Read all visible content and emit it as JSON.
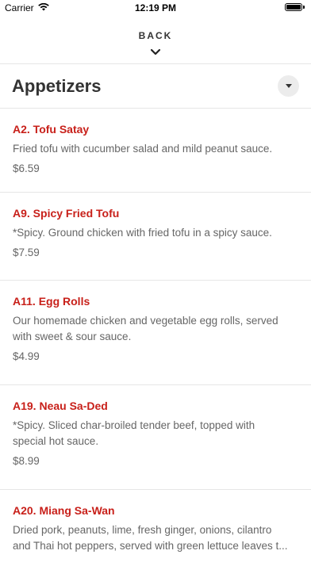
{
  "status_bar": {
    "carrier": "Carrier",
    "time": "12:19 PM",
    "battery_level": 1.0
  },
  "header": {
    "back_label": "BACK"
  },
  "section": {
    "title": "Appetizers"
  },
  "items": [
    {
      "name": "A2. Tofu Satay",
      "description_lines": [
        "Fried tofu with cucumber salad and mild peanut sauce."
      ],
      "price": "$6.59"
    },
    {
      "name": "A9. Spicy Fried Tofu",
      "description_lines": [
        "*Spicy. Ground chicken with fried tofu in a spicy sauce."
      ],
      "price": "$7.59"
    },
    {
      "name": "A11. Egg Rolls",
      "description_lines": [
        "Our homemade chicken and vegetable egg rolls, served",
        "with sweet & sour sauce."
      ],
      "price": "$4.99"
    },
    {
      "name": "A19. Neau Sa-Ded",
      "description_lines": [
        "*Spicy. Sliced char-broiled tender beef, topped with",
        "special hot sauce."
      ],
      "price": "$8.99"
    },
    {
      "name": "A20. Miang Sa-Wan",
      "description_lines": [
        "Dried pork, peanuts, lime, fresh ginger, onions, cilantro",
        "and Thai hot peppers, served with green lettuce leaves t..."
      ],
      "price": ""
    }
  ],
  "colors": {
    "item_name": "#c8201a",
    "text_secondary": "#666666",
    "divider": "#e6e6e6"
  },
  "icons": {
    "back": "chevron-down-icon",
    "section_toggle": "triangle-down-icon",
    "wifi": "wifi-icon",
    "battery": "battery-icon"
  }
}
